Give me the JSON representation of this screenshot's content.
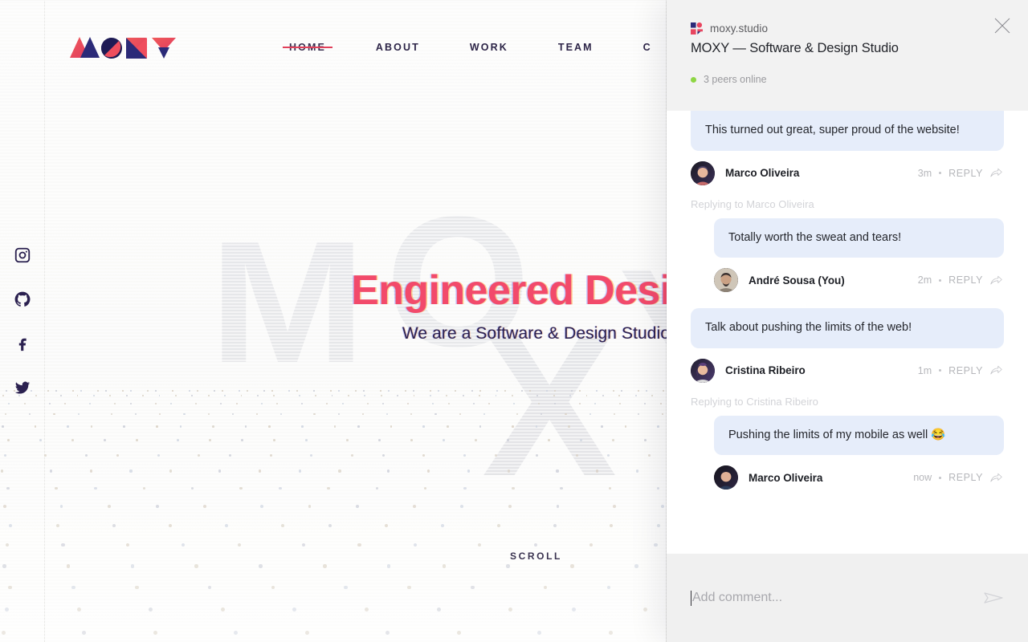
{
  "site": {
    "logo_alt": "MOXY",
    "nav": [
      {
        "label": "HOME",
        "active": true
      },
      {
        "label": "ABOUT",
        "active": false
      },
      {
        "label": "WORK",
        "active": false
      },
      {
        "label": "TEAM",
        "active": false
      },
      {
        "label": "C",
        "active": false
      }
    ],
    "hero": {
      "title": "Engineered Design",
      "subtitle": "We are a Software & Design Studio",
      "title_color": "#f24a6b",
      "subtitle_color": "#2b2150"
    },
    "scroll_label": "SCROLL",
    "watermark_letters": [
      "M",
      "O",
      "X",
      "Y"
    ],
    "social": [
      {
        "name": "instagram-icon"
      },
      {
        "name": "github-icon"
      },
      {
        "name": "facebook-icon"
      },
      {
        "name": "twitter-icon"
      }
    ]
  },
  "panel": {
    "site_name": "moxy.studio",
    "page_title": "MOXY — Software & Design Studio",
    "peers_online": "3 peers online",
    "peer_status_color": "#8ed644",
    "close_label": "close-icon",
    "messages": [
      {
        "text": "This turned out great, super proud of the website!",
        "author": "Marco Oliveira",
        "time": "3m",
        "reply_label": "REPLY",
        "reply_context": null,
        "is_reply": false
      },
      {
        "text": "Totally worth the sweat and tears!",
        "author": "André Sousa (You)",
        "time": "2m",
        "reply_label": "REPLY",
        "reply_context": "Replying to Marco Oliveira",
        "is_reply": true
      },
      {
        "text": "Talk about pushing the limits of the web!",
        "author": "Cristina Ribeiro",
        "time": "1m",
        "reply_label": "REPLY",
        "reply_context": null,
        "is_reply": false
      },
      {
        "text": "Pushing the limits of my mobile as well 😂",
        "author": "Marco Oliveira",
        "time": "now",
        "reply_label": "REPLY",
        "reply_context": "Replying to Cristina Ribeiro",
        "is_reply": true
      }
    ],
    "composer": {
      "placeholder": "Add comment...",
      "value": "",
      "send_label": "send-icon"
    },
    "bubble_color": "#e6edfa",
    "header_bg": "#f2f2f2",
    "footer_bg": "#f0f0f0"
  }
}
